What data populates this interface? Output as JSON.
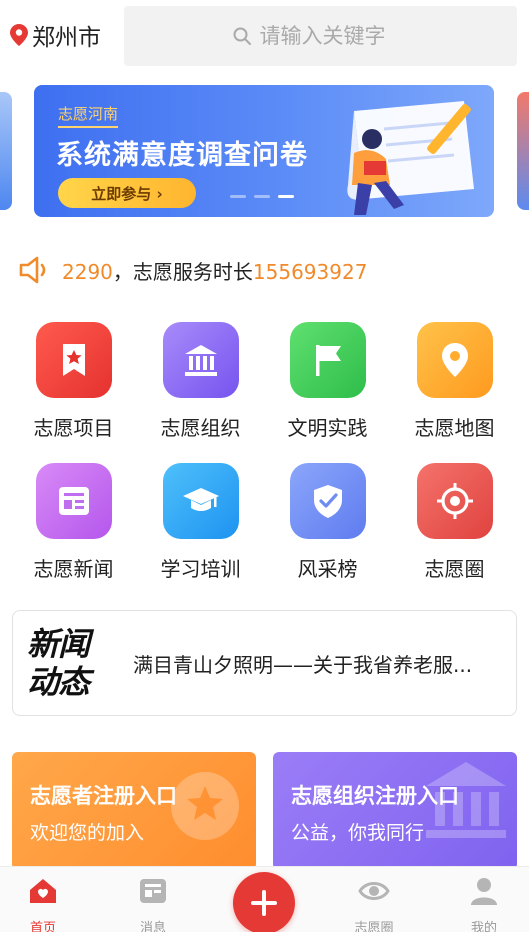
{
  "header": {
    "city": "郑州市",
    "search_placeholder": "请输入关键字"
  },
  "banner": {
    "tag": "志愿河南",
    "title": "系统满意度调查问卷",
    "button": "立即参与 ›",
    "slide_count": 3,
    "active_slide": 3
  },
  "notice": {
    "count_fragment": "2290",
    "text": "，志愿服务时长",
    "hours": "155693927"
  },
  "grid": [
    {
      "label": "志愿项目",
      "icon": "bookmark-star-icon",
      "color": "#f44336"
    },
    {
      "label": "志愿组织",
      "icon": "institution-icon",
      "color": "#8b6cf6"
    },
    {
      "label": "文明实践",
      "icon": "flag-icon",
      "color": "#3fcf5a"
    },
    {
      "label": "志愿地图",
      "icon": "map-pin-icon",
      "color": "#ffaa2a"
    },
    {
      "label": "志愿新闻",
      "icon": "newspaper-icon",
      "color": "#c46cf0"
    },
    {
      "label": "学习培训",
      "icon": "graduation-cap-icon",
      "color": "#2fa6f5"
    },
    {
      "label": "风采榜",
      "icon": "shield-check-icon",
      "color": "#6f8cf2"
    },
    {
      "label": "志愿圈",
      "icon": "target-icon",
      "color": "#ec5b57"
    }
  ],
  "news": {
    "logo_line1": "新闻",
    "logo_line2": "动态",
    "headline": "满目青山夕照明——关于我省养老服..."
  },
  "cards": {
    "volunteer": {
      "title": "志愿者注册入口",
      "subtitle": "欢迎您的加入"
    },
    "organization": {
      "title": "志愿组织注册入口",
      "subtitle": "公益，你我同行"
    }
  },
  "tabbar": {
    "home": "首页",
    "messages": "消息",
    "circle": "志愿圈",
    "mine": "我的"
  },
  "colors": {
    "brand_red": "#e53935",
    "accent_orange": "#f08a2a"
  }
}
